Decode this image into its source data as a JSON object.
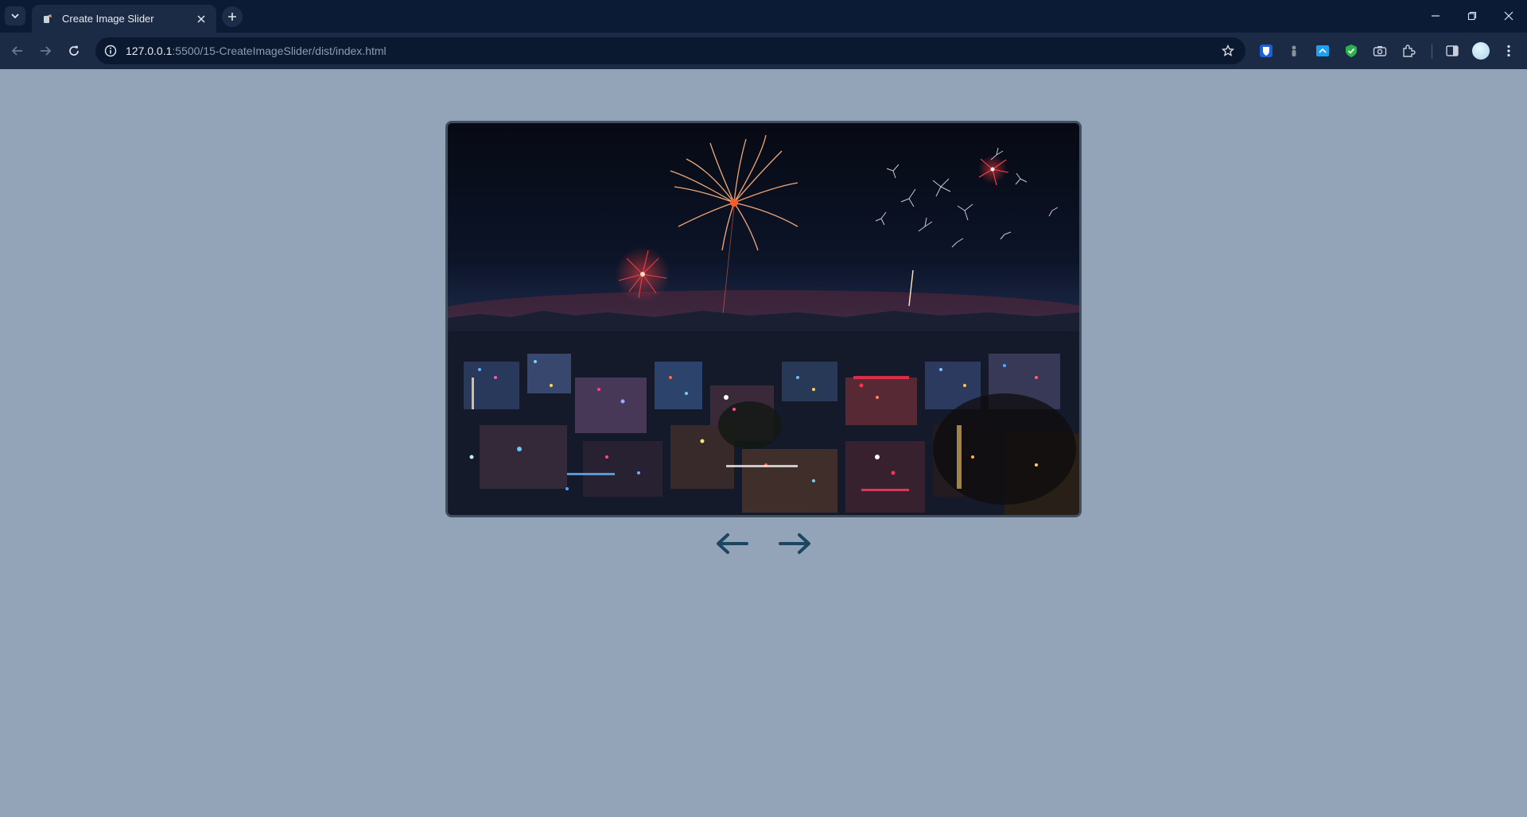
{
  "browser": {
    "tab_title": "Create Image Slider",
    "url_host": "127.0.0.1",
    "url_rest": ":5500/15-CreateImageSlider/dist/index.html"
  },
  "slider": {
    "slide_image": "night-city-fireworks",
    "prev_icon": "arrow-left-icon",
    "next_icon": "arrow-right-icon",
    "arrow_color": "#1c4560",
    "frame_color": "#41505f"
  },
  "colors": {
    "page_background": "#93a3b8",
    "tabbar": "#0b1b36",
    "toolbar": "#1c2b45"
  }
}
